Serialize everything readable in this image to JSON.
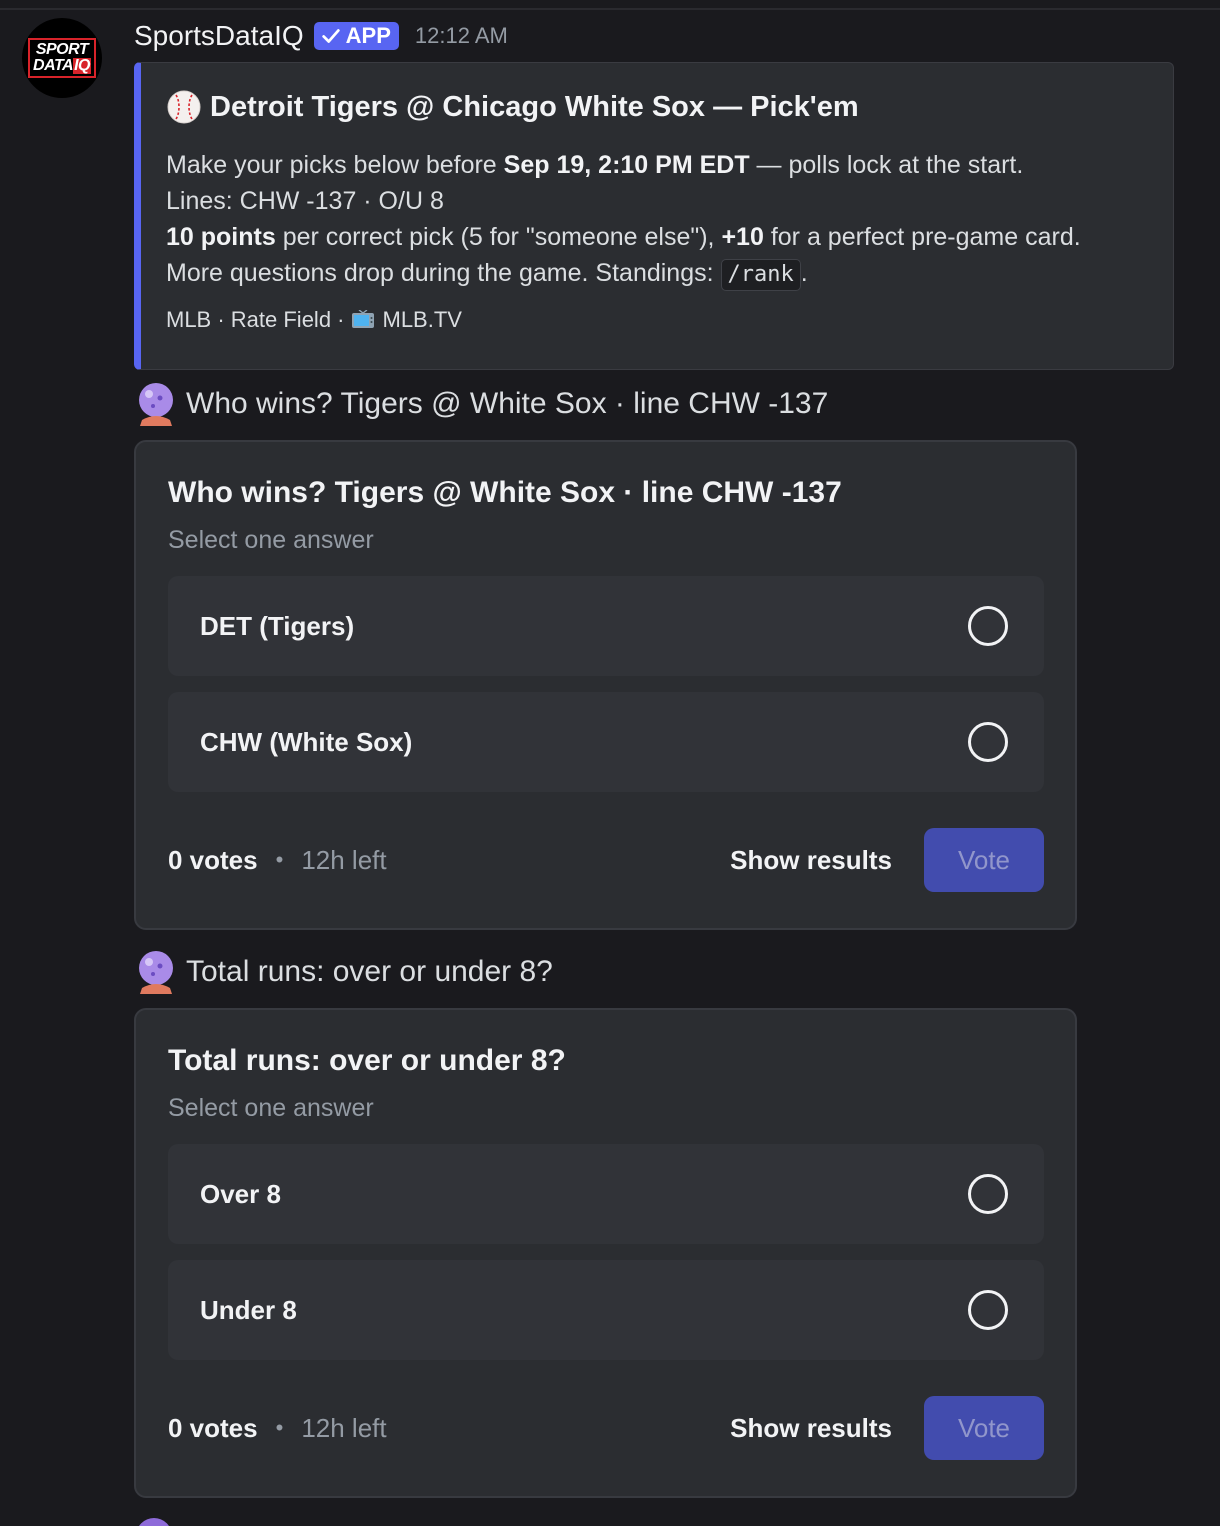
{
  "message": {
    "username": "SportsDataIQ",
    "badge": "APP",
    "timestamp": "12:12 AM",
    "avatar": {
      "line1": "SPORT",
      "line2a": "DATA",
      "line2b": "IQ"
    }
  },
  "embed": {
    "title": "Detroit Tigers @ Chicago White Sox — Pick'em",
    "line1_pre": "Make your picks below before ",
    "line1_bold": "Sep 19, 2:10 PM EDT",
    "line1_post": " — polls lock at the start.",
    "line2": "Lines: CHW -137 · O/U 8",
    "line3_bold1": "10 points",
    "line3_mid": " per correct pick (5 for \"someone else\"), ",
    "line3_bold2": "+10",
    "line3_post": " for a perfect pre-game card.",
    "line4_pre": "More questions drop during the game. Standings: ",
    "line4_code": "/rank",
    "line4_post": ".",
    "footer_left": "MLB · Rate Field · ",
    "footer_right": "MLB.TV",
    "accent": "#5865f2"
  },
  "polls": [
    {
      "caption": "Who wins? Tigers @ White Sox · line CHW -137",
      "question": "Who wins? Tigers @ White Sox · line CHW -137",
      "subtitle": "Select one answer",
      "answers": [
        "DET (Tigers)",
        "CHW (White Sox)"
      ],
      "votes": "0 votes",
      "time_left": "12h left",
      "show_results": "Show results",
      "vote": "Vote"
    },
    {
      "caption": "Total runs: over or under 8?",
      "question": "Total runs: over or under 8?",
      "subtitle": "Select one answer",
      "answers": [
        "Over 8",
        "Under 8"
      ],
      "votes": "0 votes",
      "time_left": "12h left",
      "show_results": "Show results",
      "vote": "Vote"
    }
  ],
  "separator": "•"
}
